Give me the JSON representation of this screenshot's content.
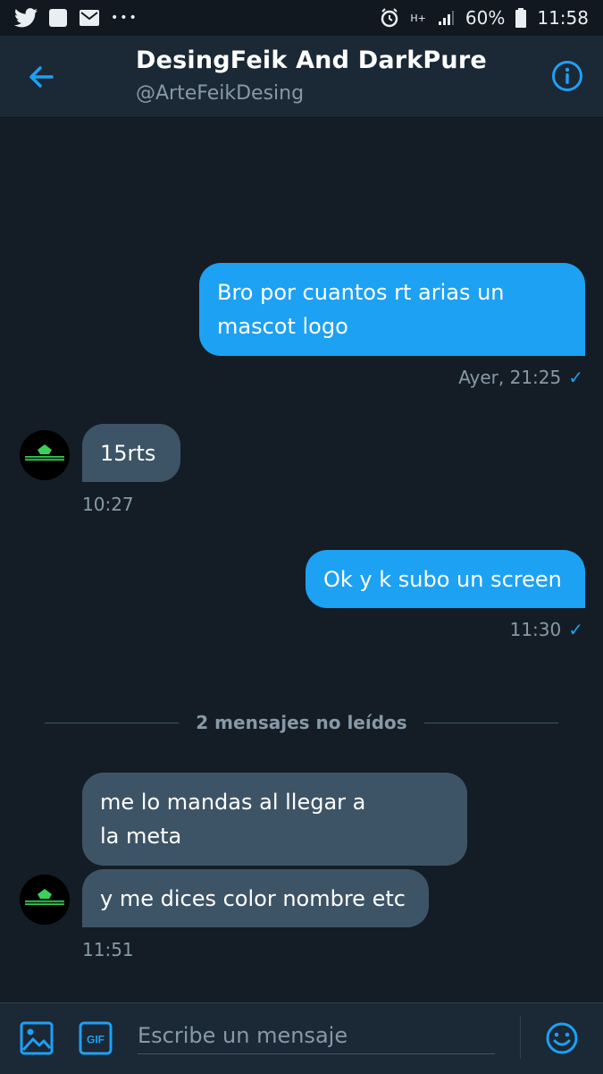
{
  "statusbar": {
    "battery": "60%",
    "time": "11:58",
    "network": "H+",
    "more": "•••"
  },
  "header": {
    "title": "DesingFeik And DarkPure",
    "handle": "@ArteFeikDesing"
  },
  "messages": {
    "m1": {
      "text": "Bro por cuantos rt arias un\nmascot logo",
      "time": "Ayer, 21:25",
      "check": "✓"
    },
    "m2": {
      "text": "15rts",
      "time": "10:27"
    },
    "m3": {
      "text": "Ok y k subo un screen",
      "time": "11:30",
      "check": "✓"
    },
    "unread": "2 mensajes no leídos",
    "m4": {
      "text": "me lo mandas al llegar a\nla meta"
    },
    "m5": {
      "text": "y me dices color nombre etc",
      "time": "11:51"
    }
  },
  "composer": {
    "placeholder": "Escribe un mensaje",
    "gif_label": "GIF"
  },
  "colors": {
    "background": "#141d26",
    "bar": "#1b2836",
    "accent": "#1da1f2",
    "incoming_bubble": "#3d5466",
    "muted_text": "#8899a6"
  },
  "icons": [
    "twitter-icon",
    "notification-icon",
    "gmail-icon",
    "alarm-icon",
    "signal-icon",
    "battery-icon",
    "back-arrow-icon",
    "info-icon",
    "image-icon",
    "gif-icon",
    "emoji-icon"
  ]
}
